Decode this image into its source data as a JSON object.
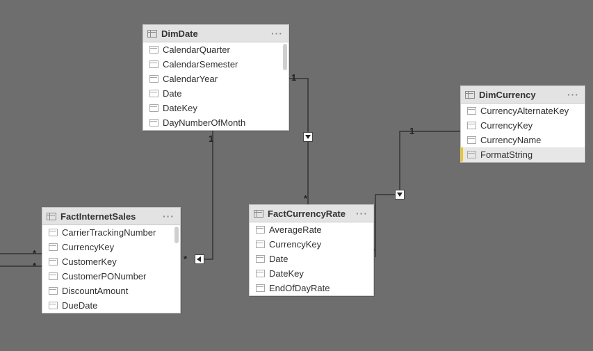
{
  "tables": {
    "dimdate": {
      "title": "DimDate",
      "columns": [
        "CalendarQuarter",
        "CalendarSemester",
        "CalendarYear",
        "Date",
        "DateKey",
        "DayNumberOfMonth"
      ]
    },
    "factinternetsales": {
      "title": "FactInternetSales",
      "columns": [
        "CarrierTrackingNumber",
        "CurrencyKey",
        "CustomerKey",
        "CustomerPONumber",
        "DiscountAmount",
        "DueDate"
      ]
    },
    "factcurrencyrate": {
      "title": "FactCurrencyRate",
      "columns": [
        "AverageRate",
        "CurrencyKey",
        "Date",
        "DateKey",
        "EndOfDayRate"
      ]
    },
    "dimcurrency": {
      "title": "DimCurrency",
      "columns": [
        "CurrencyAlternateKey",
        "CurrencyKey",
        "CurrencyName",
        "FormatString"
      ],
      "selected": "FormatString"
    }
  },
  "relationships": [
    {
      "from": "DimDate",
      "to": "FactInternetSales",
      "fromCard": "1",
      "toCard": "*"
    },
    {
      "from": "DimDate",
      "to": "FactCurrencyRate",
      "fromCard": "1",
      "toCard": "*"
    },
    {
      "from": "DimCurrency",
      "to": "FactCurrencyRate",
      "fromCard": "1",
      "toCard": "*"
    },
    {
      "from": "(external)",
      "to": "FactInternetSales",
      "fromCard": "",
      "toCard": "*"
    },
    {
      "from": "(external)",
      "to": "FactInternetSales",
      "fromCard": "",
      "toCard": "*"
    }
  ],
  "cardinality_symbols": {
    "one": "1",
    "many": "*"
  }
}
